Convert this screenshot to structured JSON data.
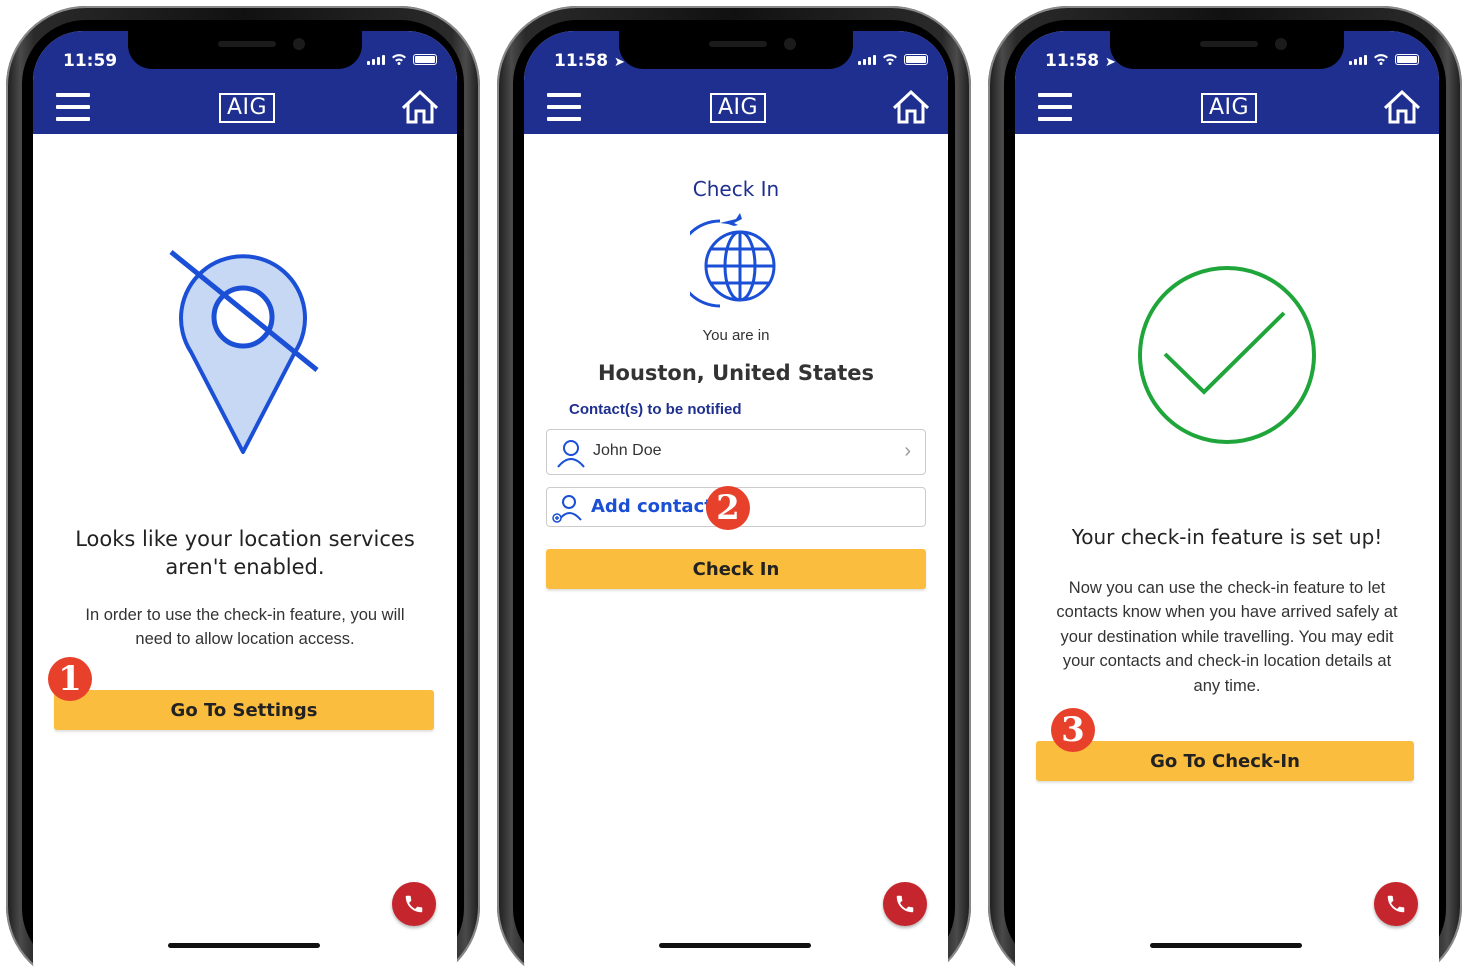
{
  "colors": {
    "header": "#1e2f8f",
    "button": "#fbbd3d",
    "accent_blue": "#1a4fd6",
    "success_green": "#1fa53a",
    "badge_red": "#e8412b",
    "call_red": "#c5262e"
  },
  "screens": [
    {
      "time": "11:59",
      "header": {
        "logo": "AIG"
      },
      "heading_line1": "Looks like your location services",
      "heading_line2": "aren't enabled.",
      "body_line1": "In order to use the check-in feature, you will",
      "body_line2": "need to allow location access.",
      "button_label": "Go To Settings",
      "step_badge": "1",
      "icon": "location-off-icon"
    },
    {
      "time": "11:58",
      "header": {
        "logo": "AIG"
      },
      "title": "Check In",
      "you_are_in": "You are in",
      "location": "Houston, United States",
      "contacts_label": "Contact(s) to be notified",
      "contact_name": "John Doe",
      "add_contact": "Add contact",
      "button_label": "Check In",
      "step_badge": "2",
      "icon": "globe-plane-icon"
    },
    {
      "time": "11:58",
      "header": {
        "logo": "AIG"
      },
      "heading": "Your check-in feature is set up!",
      "body_lines": [
        "Now you can use the check-in feature to let",
        "contacts know when you have arrived safely at",
        "your destination while travelling. You may edit",
        "your contacts and check-in location details at",
        "any time."
      ],
      "button_label": "Go To Check-In",
      "step_badge": "3",
      "icon": "checkmark-circle-icon"
    }
  ]
}
